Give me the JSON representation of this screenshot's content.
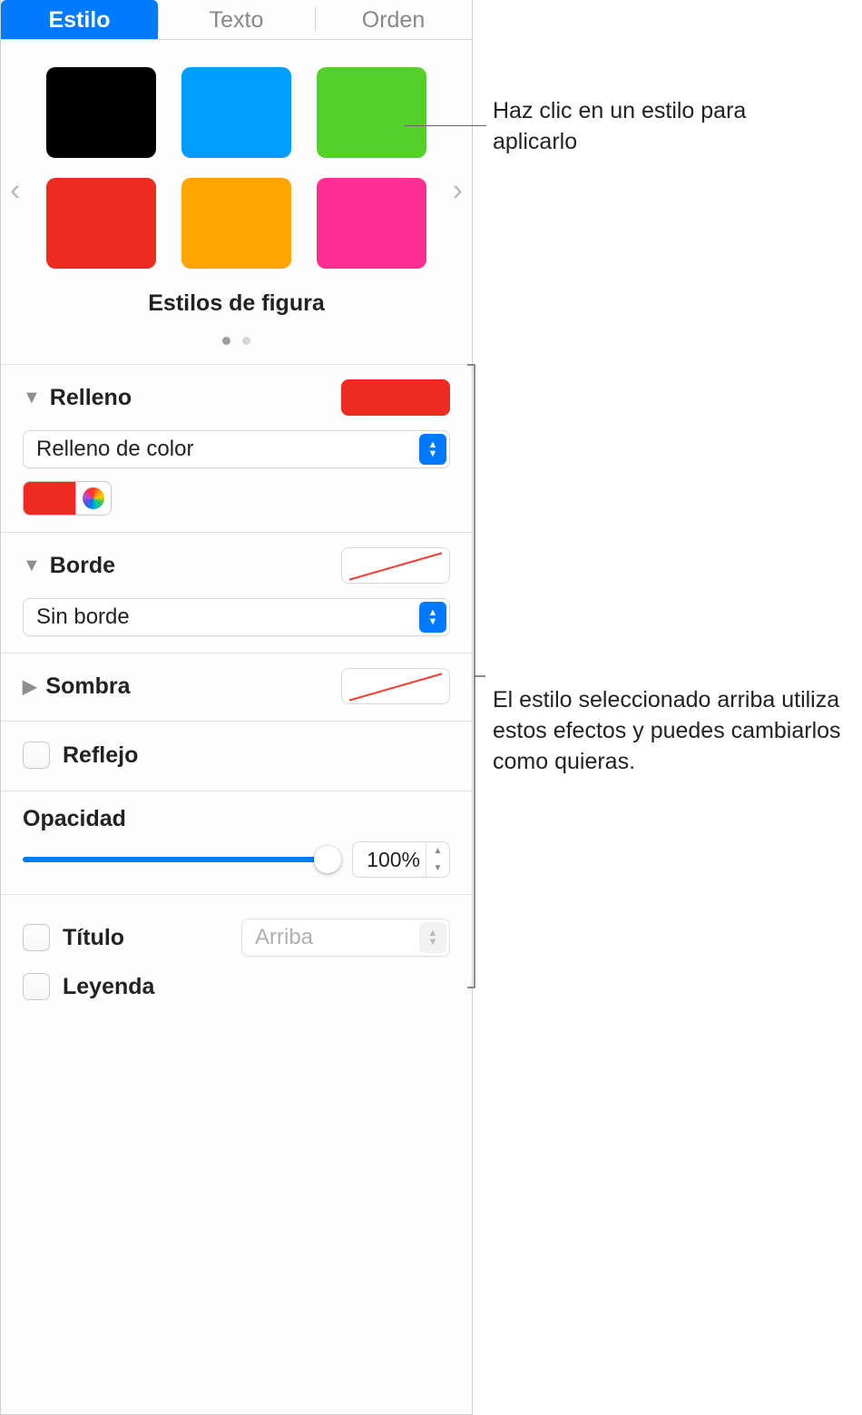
{
  "tabs": {
    "style": "Estilo",
    "text": "Texto",
    "order": "Orden"
  },
  "swatches": {
    "caption": "Estilos de figura",
    "colors": [
      "#000000",
      "#009dff",
      "#54d02a",
      "#ee2b20",
      "#ffa400",
      "#ff2e92"
    ]
  },
  "fill": {
    "label": "Relleno",
    "select": "Relleno de color",
    "color": "#ee2b20"
  },
  "border": {
    "label": "Borde",
    "select": "Sin borde"
  },
  "shadow": {
    "label": "Sombra"
  },
  "reflection": {
    "label": "Reflejo"
  },
  "opacity": {
    "label": "Opacidad",
    "value": "100%"
  },
  "title": {
    "label": "Título",
    "position": "Arriba"
  },
  "legend": {
    "label": "Leyenda"
  },
  "callouts": {
    "click_style": "Haz clic en un estilo para aplicarlo",
    "effects": "El estilo seleccionado arriba utiliza estos efectos y puedes cambiarlos como quieras."
  }
}
